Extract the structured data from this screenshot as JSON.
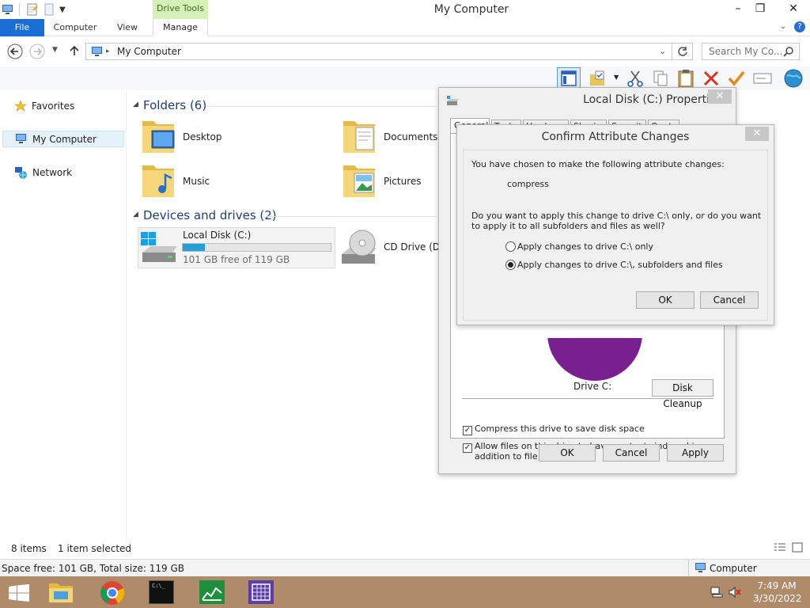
{
  "window": {
    "title": "My Computer",
    "context_tab": "Drive Tools"
  },
  "ribbon": {
    "tabs": [
      "File",
      "Computer",
      "View",
      "Manage"
    ]
  },
  "address": {
    "path": "My Computer",
    "search_placeholder": "Search My Co..."
  },
  "sidebar": {
    "favorites": "Favorites",
    "my_computer": "My Computer",
    "network": "Network"
  },
  "folders": {
    "header": "Folders (6)",
    "items": [
      "Desktop",
      "Documents",
      "Music",
      "Pictures"
    ]
  },
  "drives": {
    "header": "Devices and drives (2)",
    "local": {
      "name": "Local Disk (C:)",
      "free": "101 GB free of 119 GB",
      "used_fraction": 0.15
    },
    "cd": {
      "name": "CD Drive (D:)"
    }
  },
  "status": {
    "items": "8 items",
    "selected": "1 item selected",
    "space": "Space free: 101 GB, Total size: 119 GB",
    "computer": "Computer"
  },
  "properties": {
    "title": "Local Disk (C:) Properties",
    "tabs": [
      "General",
      "Tools",
      "Hardware",
      "Sharing",
      "Security",
      "Quota"
    ],
    "drive_label": "Drive C:",
    "disk_cleanup": "Disk Cleanup",
    "compress": "Compress this drive to save disk space",
    "index": "Allow files on this drive to have contents indexed in addition to file properties",
    "ok": "OK",
    "cancel": "Cancel",
    "apply": "Apply"
  },
  "confirm": {
    "title": "Confirm Attribute Changes",
    "intro": "You have chosen to make the following attribute changes:",
    "change": "compress",
    "question": "Do you want to apply this change to drive C:\\ only, or do you want to apply it to all subfolders and files as well?",
    "option1": "Apply changes to drive C:\\ only",
    "option2": "Apply changes to drive C:\\, subfolders and files",
    "ok": "OK",
    "cancel": "Cancel"
  },
  "taskbar": {
    "time": "7:49 AM",
    "date": "3/30/2022"
  }
}
